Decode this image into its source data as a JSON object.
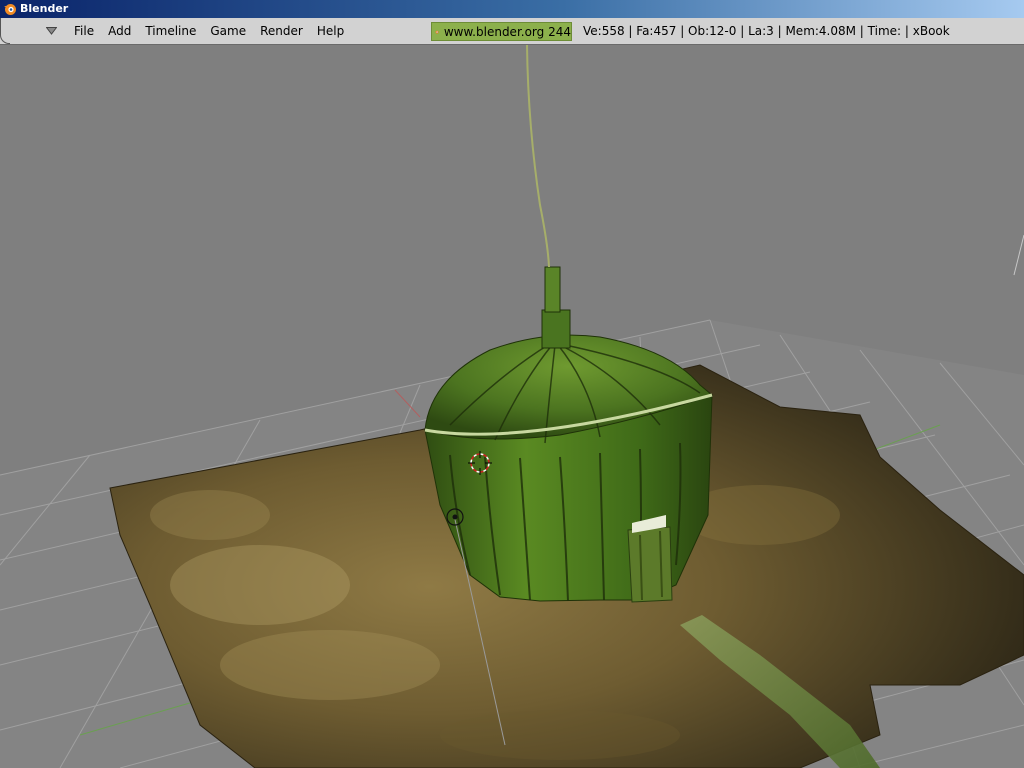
{
  "window": {
    "title": "Blender"
  },
  "menu": {
    "items": [
      {
        "id": "file",
        "label": "File"
      },
      {
        "id": "add",
        "label": "Add"
      },
      {
        "id": "timeline",
        "label": "Timeline"
      },
      {
        "id": "game",
        "label": "Game"
      },
      {
        "id": "render",
        "label": "Render"
      },
      {
        "id": "help",
        "label": "Help"
      }
    ]
  },
  "info": {
    "logo_text": "www.blender.org 244",
    "stats": "Ve:558 | Fa:457 | Ob:12-0 | La:3  | Mem:4.08M  | Time: | xBook"
  },
  "colors": {
    "viewport_bg": "#7f7f7f",
    "grid": "#9a9a9a",
    "ground": "#6b5a30",
    "hut": "#4f7a1e",
    "logo_bg": "#8cb04c"
  },
  "icons": {
    "app": "blender-logo-icon",
    "menu_toggle": "triangle-down-icon",
    "cursor": "3d-cursor-icon",
    "lamp": "lamp-icon"
  }
}
